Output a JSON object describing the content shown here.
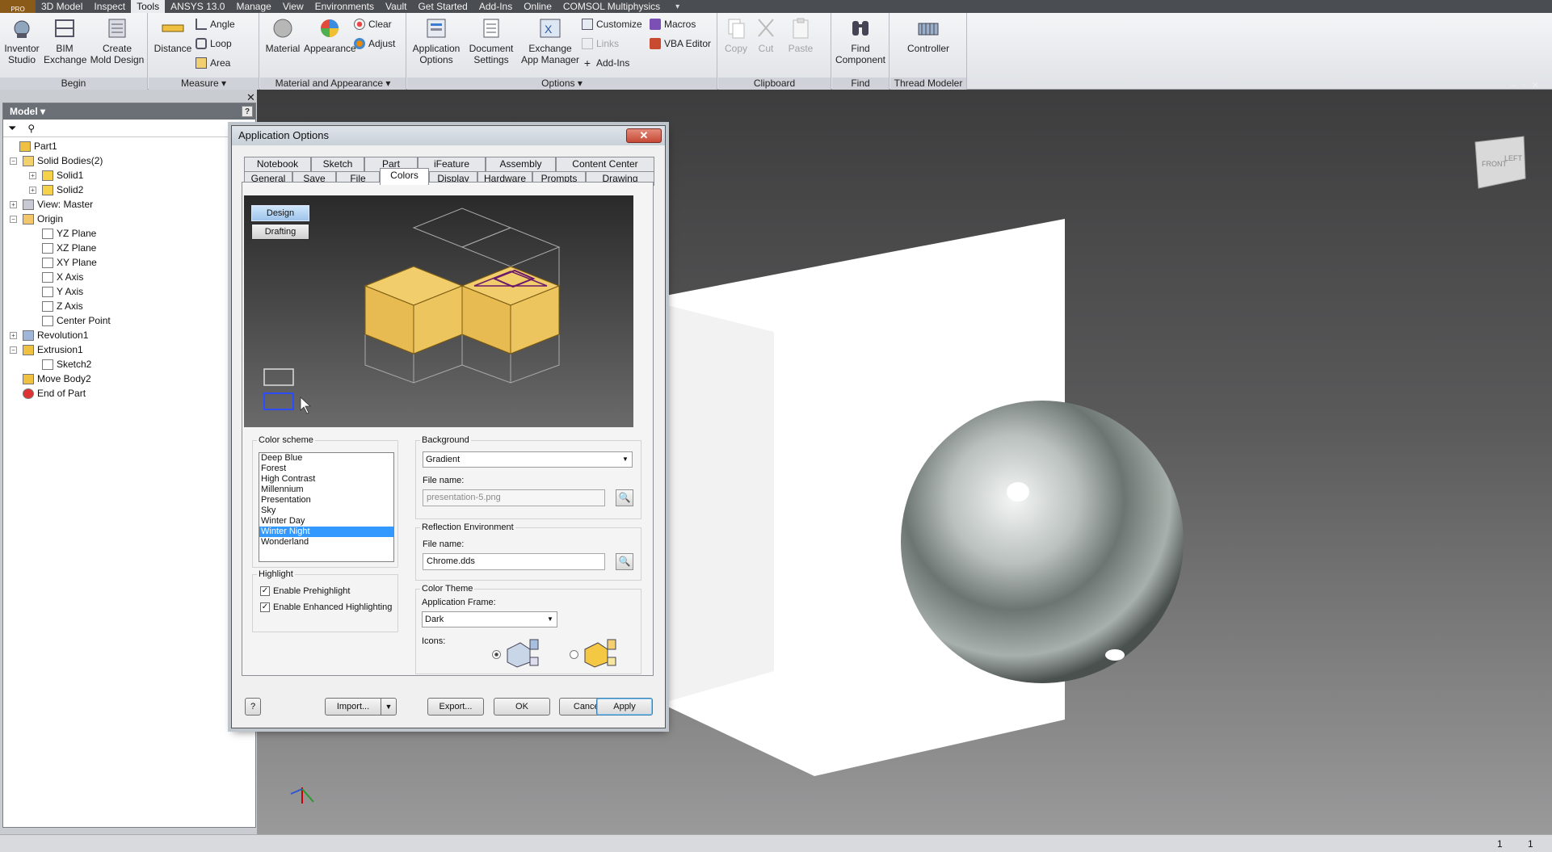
{
  "menubar": {
    "logo": "PRO",
    "items": [
      "3D Model",
      "Inspect",
      "Tools",
      "ANSYS 13.0",
      "Manage",
      "View",
      "Environments",
      "Vault",
      "Get Started",
      "Add-Ins",
      "Online",
      "COMSOL Multiphysics"
    ],
    "active": "Tools",
    "qat": "▾"
  },
  "ribbon": {
    "begin": {
      "label": "Begin",
      "inventor_studio": "Inventor\nStudio",
      "bim_exchange": "BIM\nExchange",
      "create_mold": "Create\nMold Design"
    },
    "measure": {
      "label": "Measure",
      "distance": "Distance",
      "angle": "Angle",
      "loop": "Loop",
      "area": "Area"
    },
    "material_appearance": {
      "label": "Material and Appearance",
      "material": "Material",
      "appearance": "Appearance",
      "clear": "Clear",
      "adjust": "Adjust"
    },
    "options": {
      "label": "Options",
      "application_options": "Application\nOptions",
      "document_settings": "Document\nSettings",
      "exchange_app_manager": "Exchange\nApp Manager",
      "customize": "Customize",
      "links": "Links",
      "add_ins": "Add-Ins",
      "macros": "Macros",
      "vba_editor": "VBA Editor"
    },
    "clipboard": {
      "label": "Clipboard",
      "copy": "Copy",
      "cut": "Cut",
      "paste": "Paste"
    },
    "find": {
      "label": "Find",
      "find_component": "Find\nComponent"
    },
    "thread_modeler": {
      "label": "Thread Modeler",
      "controller": "Controller"
    }
  },
  "browser": {
    "title": "Model ▾",
    "help": "?",
    "close": "✕",
    "tree": [
      {
        "label": "Part1"
      },
      {
        "label": "Solid Bodies(2)"
      },
      {
        "label": "Solid1"
      },
      {
        "label": "Solid2"
      },
      {
        "label": "View: Master"
      },
      {
        "label": "Origin"
      },
      {
        "label": "YZ Plane"
      },
      {
        "label": "XZ Plane"
      },
      {
        "label": "XY Plane"
      },
      {
        "label": "X Axis"
      },
      {
        "label": "Y Axis"
      },
      {
        "label": "Z Axis"
      },
      {
        "label": "Center Point"
      },
      {
        "label": "Revolution1"
      },
      {
        "label": "Extrusion1"
      },
      {
        "label": "Sketch2"
      },
      {
        "label": "Move Body2"
      },
      {
        "label": "End of Part"
      }
    ]
  },
  "dialog": {
    "title": "Application Options",
    "close": "✕",
    "tabs_row1": [
      "Notebook",
      "Sketch",
      "Part",
      "iFeature",
      "Assembly",
      "Content Center"
    ],
    "tabs_row2": [
      "General",
      "Save",
      "File",
      "Colors",
      "Display",
      "Hardware",
      "Prompts",
      "Drawing"
    ],
    "active_tab": "Colors",
    "preview": {
      "design": "Design",
      "drafting": "Drafting"
    },
    "color_scheme": {
      "label": "Color scheme",
      "items": [
        "Deep Blue",
        "Forest",
        "High Contrast",
        "Millennium",
        "Presentation",
        "Sky",
        "Winter Day",
        "Winter Night",
        "Wonderland"
      ],
      "selected": "Winter Night"
    },
    "background": {
      "label": "Background",
      "value": "Gradient",
      "file_label": "File name:",
      "file_value": "presentation-5.png"
    },
    "reflection": {
      "label": "Reflection Environment",
      "file_label": "File name:",
      "file_value": "Chrome.dds"
    },
    "highlight": {
      "label": "Highlight",
      "prehighlight": "Enable Prehighlight",
      "enhanced": "Enable Enhanced Highlighting"
    },
    "color_theme": {
      "label": "Color Theme",
      "frame_label": "Application Frame:",
      "frame_value": "Dark",
      "icons_label": "Icons:"
    },
    "buttons": {
      "help": "?",
      "import": "Import...",
      "export": "Export...",
      "ok": "OK",
      "cancel": "Cancel",
      "apply": "Apply"
    }
  },
  "viewcube": {
    "front": "FRONT",
    "left": "LEFT"
  },
  "status": {
    "left": "1",
    "right": "1"
  }
}
